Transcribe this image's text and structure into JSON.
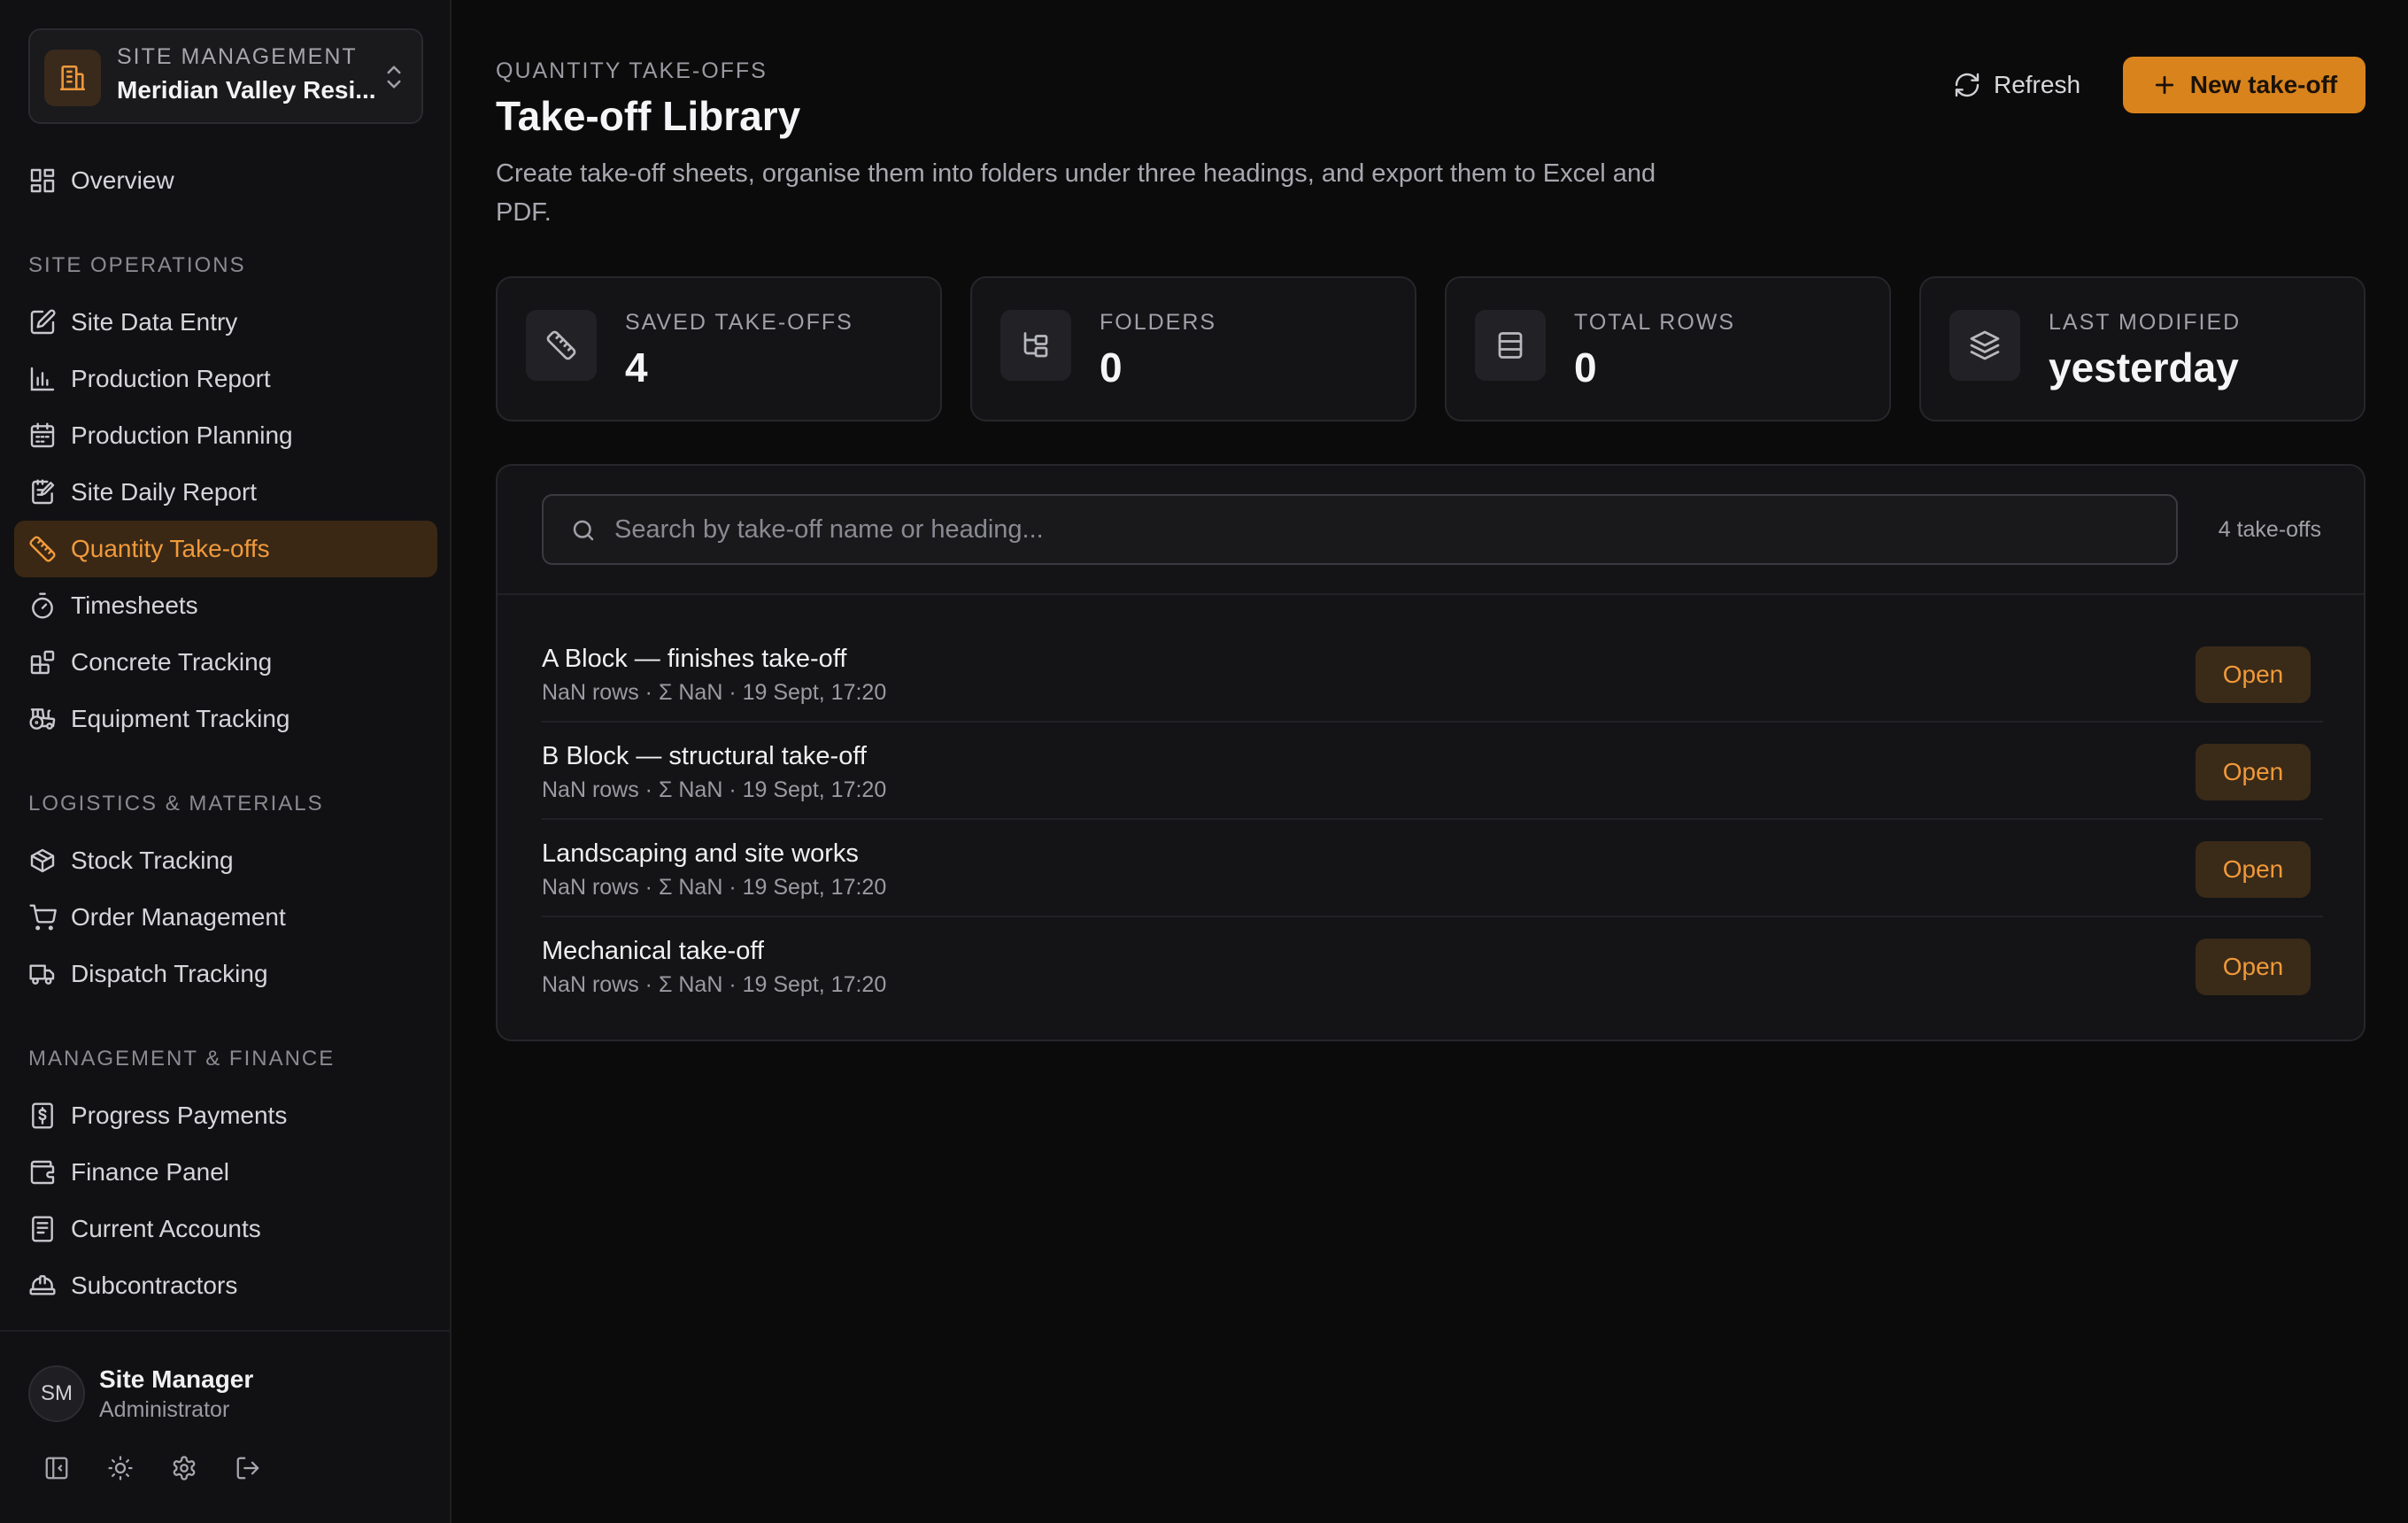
{
  "sidebar": {
    "switcher": {
      "label": "SITE MANAGEMENT",
      "site_name": "Meridian Valley Resi..."
    },
    "overview": {
      "label": "Overview",
      "icon": "grid-icon"
    },
    "sections": [
      {
        "title": "SITE OPERATIONS",
        "items": [
          {
            "label": "Site Data Entry",
            "icon": "edit-icon"
          },
          {
            "label": "Production Report",
            "icon": "bar-chart-icon"
          },
          {
            "label": "Production Planning",
            "icon": "calendar-icon"
          },
          {
            "label": "Site Daily Report",
            "icon": "notepad-icon"
          },
          {
            "label": "Quantity Take-offs",
            "icon": "ruler-icon",
            "active": true
          },
          {
            "label": "Timesheets",
            "icon": "timer-icon"
          },
          {
            "label": "Concrete Tracking",
            "icon": "blocks-icon"
          },
          {
            "label": "Equipment Tracking",
            "icon": "tractor-icon"
          }
        ]
      },
      {
        "title": "LOGISTICS & MATERIALS",
        "items": [
          {
            "label": "Stock Tracking",
            "icon": "box-icon"
          },
          {
            "label": "Order Management",
            "icon": "cart-icon"
          },
          {
            "label": "Dispatch Tracking",
            "icon": "truck-icon"
          }
        ]
      },
      {
        "title": "MANAGEMENT & FINANCE",
        "items": [
          {
            "label": "Progress Payments",
            "icon": "dollar-receipt-icon"
          },
          {
            "label": "Finance Panel",
            "icon": "wallet-icon"
          },
          {
            "label": "Current Accounts",
            "icon": "ledger-icon"
          },
          {
            "label": "Subcontractors",
            "icon": "hard-hat-icon"
          }
        ]
      }
    ],
    "user": {
      "initials": "SM",
      "name": "Site Manager",
      "role": "Administrator"
    }
  },
  "header": {
    "eyebrow": "QUANTITY TAKE-OFFS",
    "title": "Take-off Library",
    "description": "Create take-off sheets, organise them into folders under three headings, and export them to Excel and PDF.",
    "refresh_label": "Refresh",
    "new_label": "New take-off"
  },
  "stats": [
    {
      "label": "SAVED TAKE-OFFS",
      "value": "4",
      "icon": "ruler-icon"
    },
    {
      "label": "FOLDERS",
      "value": "0",
      "icon": "folder-tree-icon"
    },
    {
      "label": "TOTAL ROWS",
      "value": "0",
      "icon": "rows-icon"
    },
    {
      "label": "LAST MODIFIED",
      "value": "yesterday",
      "icon": "layers-icon"
    }
  ],
  "list": {
    "search_placeholder": "Search by take-off name or heading...",
    "search_value": "",
    "count_label": "4 take-offs",
    "open_label": "Open",
    "items": [
      {
        "name": "A Block — finishes take-off",
        "meta": "NaN rows · Σ NaN · 19 Sept, 17:20"
      },
      {
        "name": "B Block — structural take-off",
        "meta": "NaN rows · Σ NaN · 19 Sept, 17:20"
      },
      {
        "name": "Landscaping and site works",
        "meta": "NaN rows · Σ NaN · 19 Sept, 17:20"
      },
      {
        "name": "Mechanical take-off",
        "meta": "NaN rows · Σ NaN · 19 Sept, 17:20"
      }
    ]
  },
  "colors": {
    "accent": "#d9831d",
    "accent_text": "#f09a3c",
    "background": "#0b0b0c",
    "sidebar": "#111113"
  }
}
